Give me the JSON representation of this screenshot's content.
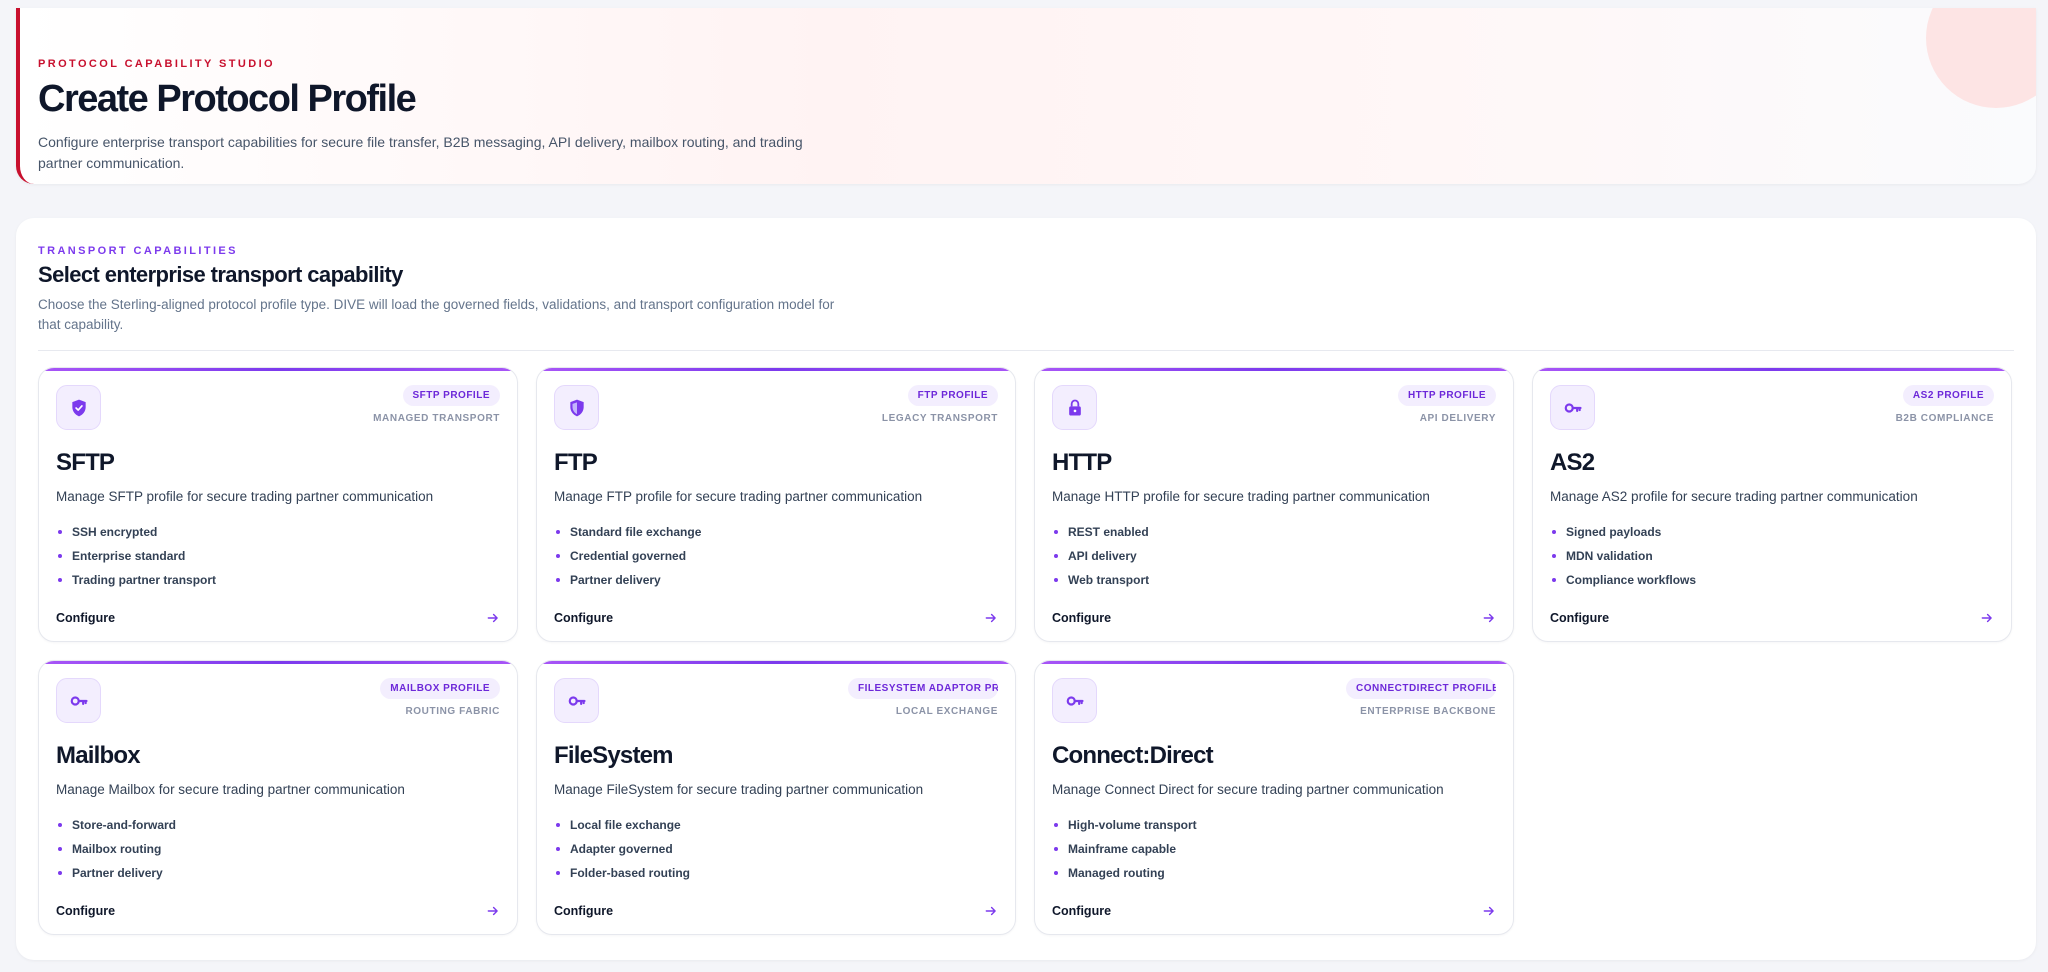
{
  "header": {
    "eyebrow": "PROTOCOL CAPABILITY STUDIO",
    "title": "Create Protocol Profile",
    "subtitle": "Configure enterprise transport capabilities for secure file transfer, B2B messaging, API delivery, mailbox routing, and trading partner communication."
  },
  "section": {
    "eyebrow": "TRANSPORT CAPABILITIES",
    "title": "Select enterprise transport capability",
    "subtitle": "Choose the Sterling-aligned protocol profile type. DIVE will load the governed fields, validations, and transport configuration model for that capability."
  },
  "cards": [
    {
      "id": "sftp",
      "icon": "shield-check-icon",
      "badge": "SFTP PROFILE",
      "tag": "MANAGED TRANSPORT",
      "title": "SFTP",
      "description": "Manage SFTP profile for secure trading partner communication",
      "features": [
        "SSH encrypted",
        "Enterprise standard",
        "Trading partner transport"
      ],
      "action": "Configure"
    },
    {
      "id": "ftp",
      "icon": "shield-half-icon",
      "badge": "FTP PROFILE",
      "tag": "LEGACY TRANSPORT",
      "title": "FTP",
      "description": "Manage FTP profile for secure trading partner communication",
      "features": [
        "Standard file exchange",
        "Credential governed",
        "Partner delivery"
      ],
      "action": "Configure"
    },
    {
      "id": "http",
      "icon": "lock-icon",
      "badge": "HTTP PROFILE",
      "tag": "API DELIVERY",
      "title": "HTTP",
      "description": "Manage HTTP profile for secure trading partner communication",
      "features": [
        "REST enabled",
        "API delivery",
        "Web transport"
      ],
      "action": "Configure"
    },
    {
      "id": "as2",
      "icon": "key-icon",
      "badge": "AS2 PROFILE",
      "tag": "B2B COMPLIANCE",
      "title": "AS2",
      "description": "Manage AS2 profile for secure trading partner communication",
      "features": [
        "Signed payloads",
        "MDN validation",
        "Compliance workflows"
      ],
      "action": "Configure"
    },
    {
      "id": "mailbox",
      "icon": "key-icon",
      "badge": "MAILBOX PROFILE",
      "tag": "ROUTING FABRIC",
      "title": "Mailbox",
      "description": "Manage Mailbox for secure trading partner communication",
      "features": [
        "Store-and-forward",
        "Mailbox routing",
        "Partner delivery"
      ],
      "action": "Configure"
    },
    {
      "id": "filesystem",
      "icon": "key-icon",
      "badge": "FILESYSTEM ADAPTOR PR",
      "tag": "LOCAL EXCHANGE",
      "title": "FileSystem",
      "description": "Manage FileSystem for secure trading partner communication",
      "features": [
        "Local file exchange",
        "Adapter governed",
        "Folder-based routing"
      ],
      "action": "Configure"
    },
    {
      "id": "connectdirect",
      "icon": "key-icon",
      "badge": "CONNECTDIRECT PROFILE",
      "tag": "ENTERPRISE BACKBONE",
      "title": "Connect:Direct",
      "description": "Manage Connect Direct for secure trading partner communication",
      "features": [
        "High-volume transport",
        "Mainframe capable",
        "Managed routing"
      ],
      "action": "Configure"
    }
  ],
  "colors": {
    "brand": "#c8102e",
    "accent": "#7c3aed",
    "text": "#0f172a",
    "muted": "#64748b"
  }
}
